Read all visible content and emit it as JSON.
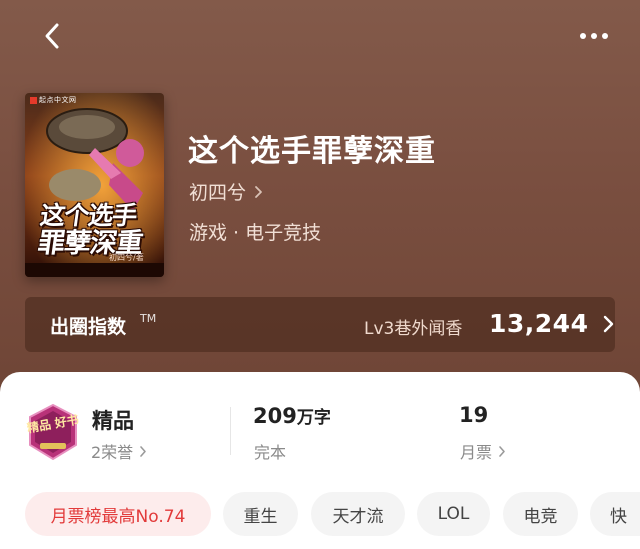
{
  "header": {
    "back_icon": "chevron-left-icon",
    "more_icon": "more-dots-icon"
  },
  "book": {
    "title": "这个选手罪孽深重",
    "author": "初四兮",
    "genre": "游戏 · 电子竞技",
    "cover": {
      "publisher": "起点中文网",
      "title_line1": "这个选手",
      "title_line2": "罪孽深重",
      "author_mark": "初四兮/著"
    }
  },
  "index": {
    "label": "出圈指数",
    "tm": "TM",
    "level": "Lv3巷外闻香",
    "value": "13,244"
  },
  "stats": {
    "honor": {
      "badge_text": "精品 好书",
      "title": "精品",
      "sub": "2荣誉"
    },
    "words": {
      "number": "209",
      "unit": "万字",
      "sub": "完本"
    },
    "tickets": {
      "number": "19",
      "sub": "月票"
    }
  },
  "tags": [
    "月票榜最高No.74",
    "重生",
    "天才流",
    "LOL",
    "电竞",
    "快"
  ],
  "colors": {
    "hero_bg": "#7a4f40",
    "rank_tag_text": "#e23a3a",
    "rank_tag_bg": "#fdecec",
    "badge": "#b83279"
  }
}
